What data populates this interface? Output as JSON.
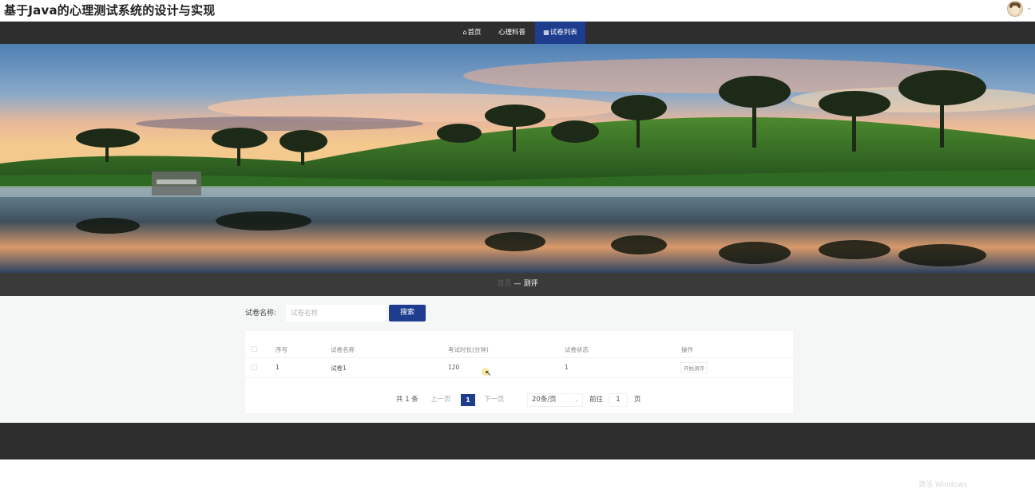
{
  "app": {
    "title": "基于Java的心理测试系统的设计与实现"
  },
  "nav": {
    "items": [
      {
        "label": "首页",
        "icon": "home-icon"
      },
      {
        "label": "心理科普",
        "icon": ""
      },
      {
        "label": "试卷列表",
        "icon": "grid-icon",
        "active": true
      }
    ]
  },
  "breadcrumb": {
    "home": "首页",
    "separator": "—",
    "current": "测评"
  },
  "search": {
    "label": "试卷名称:",
    "placeholder": "试卷名称",
    "value": "",
    "button": "搜索"
  },
  "table": {
    "columns": [
      "序号",
      "试卷名称",
      "考试时长(分钟)",
      "试卷状态",
      "操作"
    ],
    "rows": [
      {
        "index": "1",
        "name": "试卷1",
        "duration": "120",
        "status": "1",
        "action": "开始测评"
      }
    ]
  },
  "pagination": {
    "total": "共 1 条",
    "prev": "上一页",
    "current": "1",
    "next": "下一页",
    "page_size": "20条/页",
    "goto_label": "前往",
    "goto_value": "1",
    "page_suffix": "页"
  },
  "watermark": "激活 Windows",
  "colors": {
    "accent": "#1f3d8f",
    "nav_bg": "#2e2e2e",
    "content_bg": "#f5f6f6"
  }
}
